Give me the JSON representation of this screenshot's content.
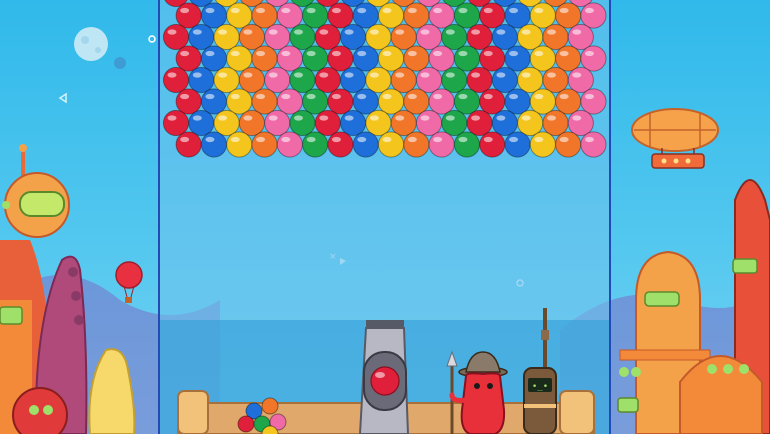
{
  "game": {
    "bubble_colors": {
      "red": "#e01f3a",
      "blue": "#1e6fd9",
      "yellow": "#f4c51c",
      "orange": "#f2762a",
      "pink": "#f06aa8",
      "green": "#1da64a"
    },
    "bubble_grid": [
      [
        "red",
        "blue",
        "yellow",
        "orange",
        "pink",
        "green",
        "red",
        "blue",
        "yellow",
        "orange",
        "pink",
        "green",
        "red",
        "blue",
        "yellow",
        "orange",
        "pink"
      ],
      [
        "red",
        "blue",
        "yellow",
        "orange",
        "pink",
        "green",
        "red",
        "blue",
        "yellow",
        "orange",
        "pink",
        "green",
        "red",
        "blue",
        "yellow",
        "orange",
        "pink"
      ],
      [
        "red",
        "blue",
        "yellow",
        "orange",
        "pink",
        "green",
        "red",
        "blue",
        "yellow",
        "orange",
        "pink",
        "green",
        "red",
        "blue",
        "yellow",
        "orange",
        "pink"
      ],
      [
        "red",
        "blue",
        "yellow",
        "orange",
        "pink",
        "green",
        "red",
        "blue",
        "yellow",
        "orange",
        "pink",
        "green",
        "red",
        "blue",
        "yellow",
        "orange",
        "pink"
      ],
      [
        "red",
        "blue",
        "yellow",
        "orange",
        "pink",
        "green",
        "red",
        "blue",
        "yellow",
        "orange",
        "pink",
        "green",
        "red",
        "blue",
        "yellow",
        "orange",
        "pink"
      ],
      [
        "red",
        "blue",
        "yellow",
        "orange",
        "pink",
        "green",
        "red",
        "blue",
        "yellow",
        "orange",
        "pink",
        "green",
        "red",
        "blue",
        "yellow",
        "orange",
        "pink"
      ],
      [
        "red",
        "blue",
        "yellow",
        "orange",
        "pink",
        "green",
        "red",
        "blue",
        "yellow",
        "orange",
        "pink",
        "green",
        "red",
        "blue",
        "yellow",
        "orange",
        "pink"
      ],
      [
        "red",
        "blue",
        "yellow",
        "orange",
        "pink",
        "green",
        "red",
        "blue",
        "yellow",
        "orange",
        "pink",
        "green",
        "red",
        "blue",
        "yellow",
        "orange",
        "pink"
      ]
    ],
    "loaded_bubble": "red",
    "reserve_bubbles": [
      "blue",
      "orange",
      "red",
      "green",
      "pink",
      "yellow"
    ],
    "robot_face": "•_•"
  }
}
